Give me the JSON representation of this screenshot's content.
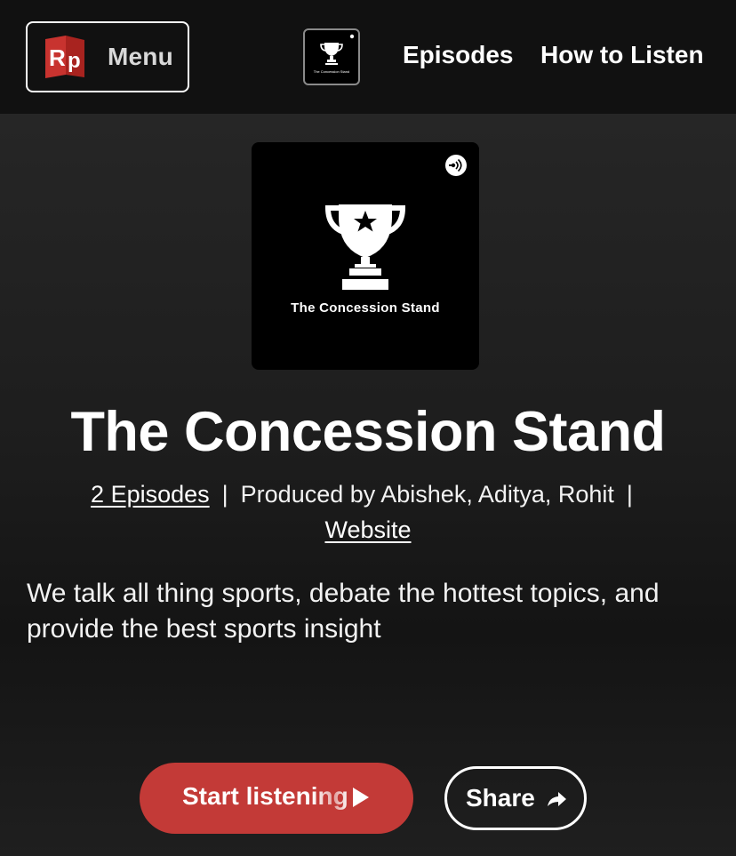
{
  "header": {
    "menu_label": "Menu",
    "logo_text": "Rp",
    "thumbnail_caption": "The Concession Stand",
    "nav": [
      {
        "label": "Episodes"
      },
      {
        "label": "How to Listen"
      }
    ]
  },
  "podcast": {
    "cover_caption": "The Concession Stand",
    "title": "The Concession Stand",
    "episodes_link": "2 Episodes",
    "separator": "|",
    "producers": "Produced by Abishek, Aditya, Rohit",
    "website_link": "Website",
    "description": "We talk all thing sports, debate the hottest topics, and provide the best sports insight"
  },
  "actions": {
    "start_label": "Start listening",
    "share_label": "Share"
  },
  "colors": {
    "header_bg": "#111111",
    "brand_red": "#c33a37",
    "text": "#ffffff"
  },
  "icons": {
    "logo": "radiopublic-logo-icon",
    "trophy": "trophy-icon",
    "podcast_badge": "podcast-icon",
    "play": "play-icon",
    "share": "share-arrow-icon"
  }
}
